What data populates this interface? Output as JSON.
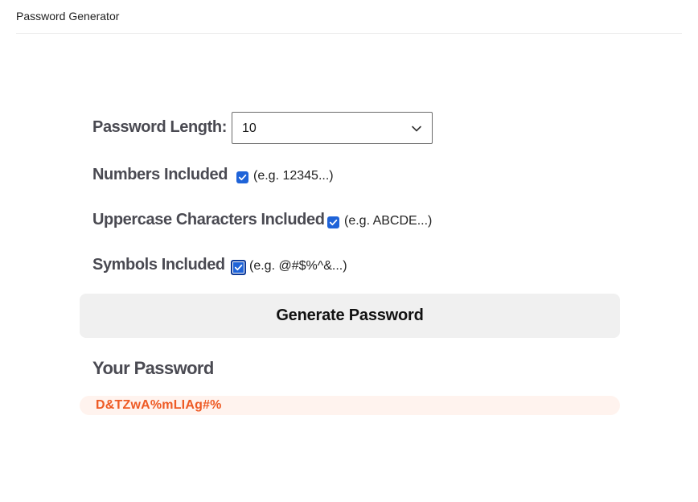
{
  "header": {
    "title": "Password Generator"
  },
  "form": {
    "length_label": "Password Length:",
    "length_value": "10",
    "numbers": {
      "label": "Numbers Included",
      "hint": "(e.g. 12345...)",
      "checked": true
    },
    "uppercase": {
      "label": "Uppercase Characters Included",
      "hint": "(e.g. ABCDE...)",
      "checked": true
    },
    "symbols": {
      "label": "Symbols Included",
      "hint": "(e.g. @#$%^&...)",
      "checked": true
    },
    "generate_label": "Generate Password"
  },
  "result": {
    "title": "Your Password",
    "password": "D&TZwA%mLIAg#%"
  },
  "colors": {
    "checkbox": "#1f63d8",
    "password_text": "#ee5a24",
    "password_bg": "#fff3ee",
    "button_bg": "#f0f0f0"
  },
  "icons": {
    "select": "chevron-down-icon",
    "checkbox": "checkmark-icon"
  }
}
